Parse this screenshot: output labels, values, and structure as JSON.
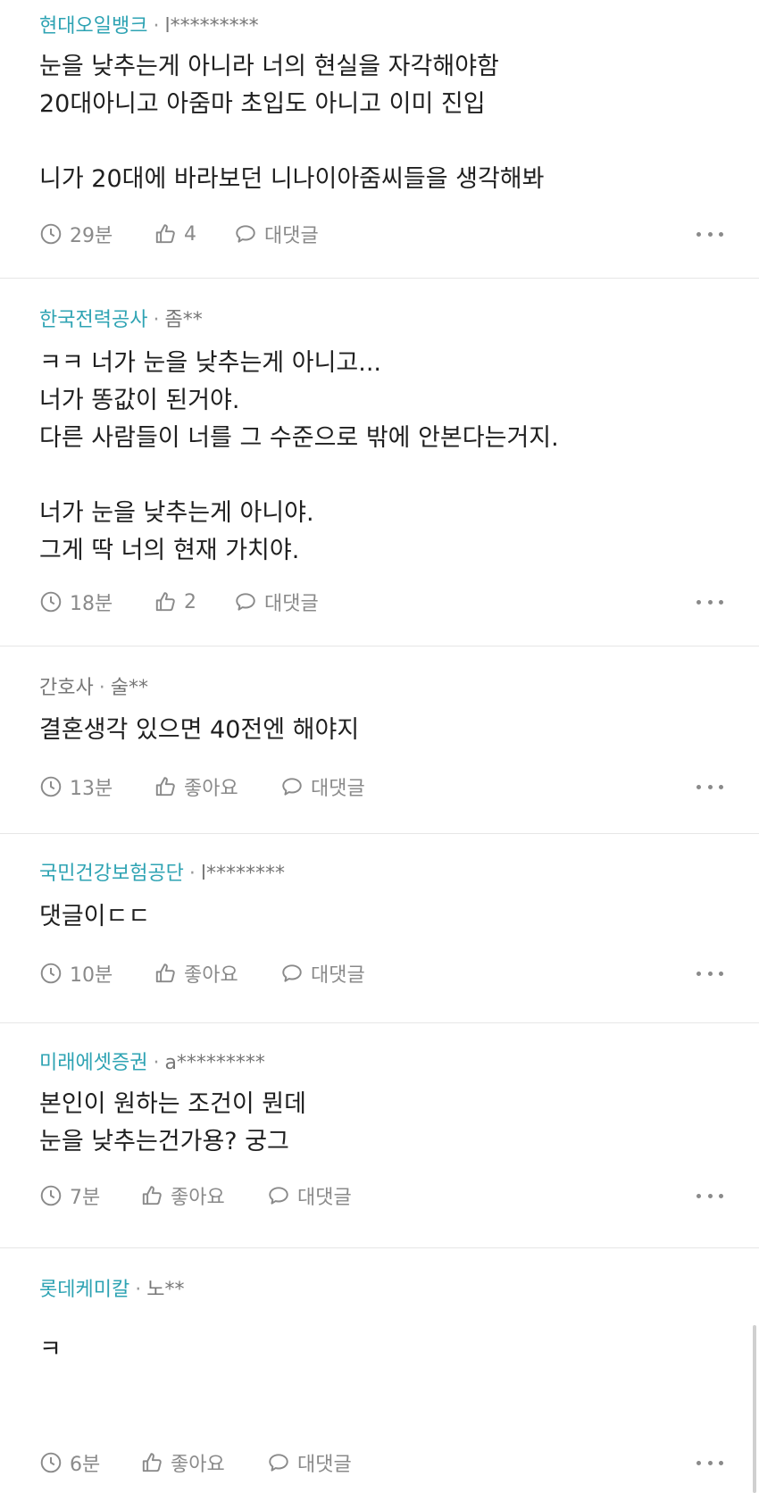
{
  "comments": [
    {
      "company": "현대오일뱅크",
      "user": "l*********",
      "lines": [
        "눈을 낮추는게 아니라 너의 현실을 자각해야함",
        "20대아니고 아줌마 초입도 아니고 이미 진입",
        "",
        "니가 20대에 바라보던 니나이아줌씨들을 생각해봐"
      ],
      "time": "29분",
      "likes": "4",
      "reply": "대댓글"
    },
    {
      "company": "한국전력공사",
      "user": "좀**",
      "lines": [
        "ㅋㅋ 너가 눈을 낮추는게 아니고...",
        "너가 똥값이 된거야.",
        "다른 사람들이 너를 그 수준으로 밖에 안본다는거지.",
        "",
        "너가 눈을 낮추는게 아니야.",
        "그게 딱 너의 현재 가치야."
      ],
      "time": "18분",
      "likes": "2",
      "reply": "대댓글"
    },
    {
      "company": "간호사",
      "user": "술**",
      "lines": [
        "결혼생각 있으면 40전엔 해야지"
      ],
      "time": "13분",
      "likes": "좋아요",
      "reply": "대댓글"
    },
    {
      "company": "국민건강보험공단",
      "user": "l********",
      "lines": [
        "댓글이ㄷㄷ"
      ],
      "time": "10분",
      "likes": "좋아요",
      "reply": "대댓글"
    },
    {
      "company": "미래에셋증권",
      "user": "a*********",
      "lines": [
        "본인이 원하는 조건이 뭔데",
        "눈을 낮추는건가용? 궁그"
      ],
      "time": "7분",
      "likes": "좋아요",
      "reply": "대댓글"
    },
    {
      "company": "롯데케미칼",
      "user": "노**",
      "lines": [
        "ㅋ"
      ],
      "time": "6분",
      "likes": "좋아요",
      "reply": "대댓글"
    }
  ],
  "separator": "·",
  "icons": {
    "time": "clock-icon",
    "like": "thumbs-up-icon",
    "reply": "speech-bubble-icon",
    "more": "more-dots-icon"
  },
  "colors": {
    "company": "#2ea3b3",
    "muted": "#8a8a8a",
    "divider": "#e6e6e6"
  }
}
